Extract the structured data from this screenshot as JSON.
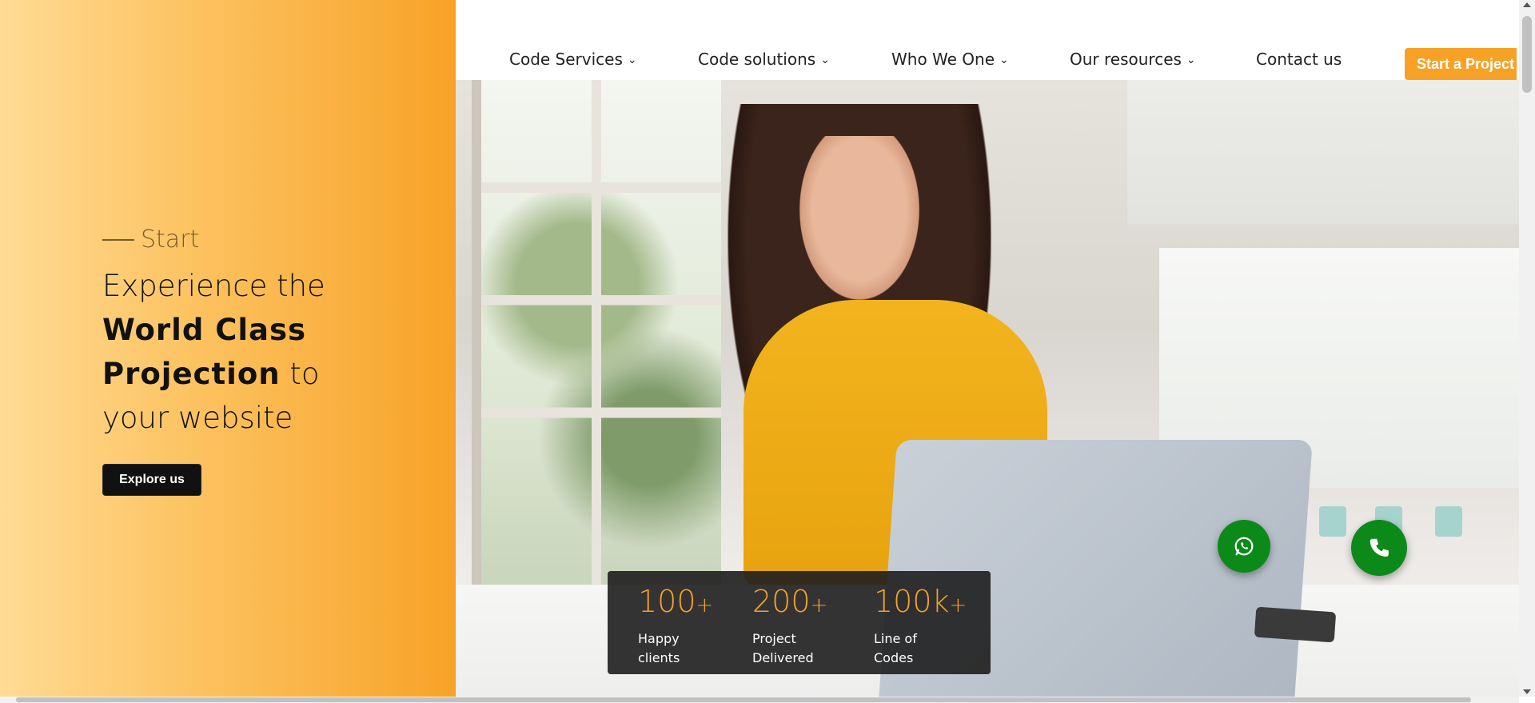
{
  "hero": {
    "eyebrow": "Start",
    "headline_line1": "Experience the",
    "headline_bold": "World Class Projection",
    "headline_after_bold": " to",
    "headline_line3": "your website",
    "explore_label": "Explore us"
  },
  "nav": {
    "items": [
      {
        "label": "Code Services",
        "has_dropdown": true
      },
      {
        "label": "Code solutions",
        "has_dropdown": true
      },
      {
        "label": "Who We One",
        "has_dropdown": true
      },
      {
        "label": "Our resources",
        "has_dropdown": true
      },
      {
        "label": "Contact us",
        "has_dropdown": false
      }
    ],
    "cta_label": "Start a Project"
  },
  "stats": [
    {
      "number": "100",
      "suffix": "+",
      "label": "Happy\nclients"
    },
    {
      "number": "200",
      "suffix": "+",
      "label": "Project\nDelivered"
    },
    {
      "number": "100k",
      "suffix": "+",
      "label": "Line of\nCodes"
    }
  ],
  "floating_buttons": {
    "whatsapp_icon": "whatsapp-icon",
    "phone_icon": "phone-icon"
  },
  "colors": {
    "accent": "#f7a227",
    "dark": "#111111",
    "fab_green": "#0b8a1a"
  }
}
